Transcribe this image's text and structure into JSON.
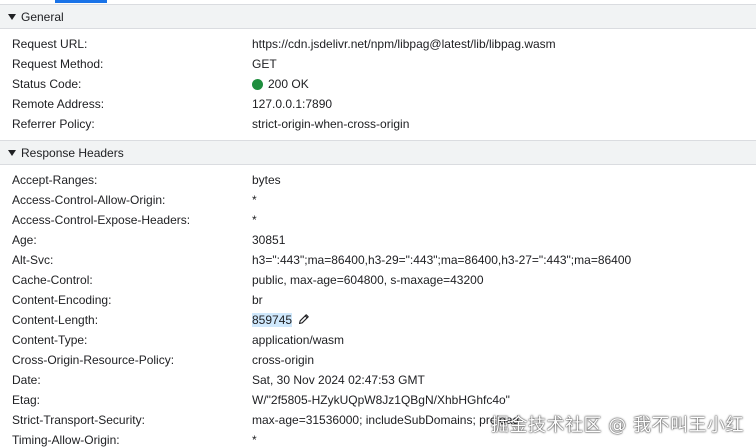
{
  "colors": {
    "status_ok": "#1e8e3e",
    "section_bg": "#f1f3f4",
    "selection_bg": "#cfe8fc",
    "tab_accent": "#1a73e8"
  },
  "general": {
    "title": "General",
    "rows": [
      {
        "key": "Request URL:",
        "value": "https://cdn.jsdelivr.net/npm/libpag@latest/lib/libpag.wasm"
      },
      {
        "key": "Request Method:",
        "value": "GET"
      },
      {
        "key": "Status Code:",
        "value": "200 OK"
      },
      {
        "key": "Remote Address:",
        "value": "127.0.0.1:7890"
      },
      {
        "key": "Referrer Policy:",
        "value": "strict-origin-when-cross-origin"
      }
    ]
  },
  "response_headers": {
    "title": "Response Headers",
    "rows": [
      {
        "key": "Accept-Ranges:",
        "value": "bytes"
      },
      {
        "key": "Access-Control-Allow-Origin:",
        "value": "*"
      },
      {
        "key": "Access-Control-Expose-Headers:",
        "value": "*"
      },
      {
        "key": "Age:",
        "value": "30851"
      },
      {
        "key": "Alt-Svc:",
        "value": "h3=\":443\";ma=86400,h3-29=\":443\";ma=86400,h3-27=\":443\";ma=86400"
      },
      {
        "key": "Cache-Control:",
        "value": "public, max-age=604800, s-maxage=43200"
      },
      {
        "key": "Content-Encoding:",
        "value": "br"
      },
      {
        "key": "Content-Length:",
        "value": "859745"
      },
      {
        "key": "Content-Type:",
        "value": "application/wasm"
      },
      {
        "key": "Cross-Origin-Resource-Policy:",
        "value": "cross-origin"
      },
      {
        "key": "Date:",
        "value": "Sat, 30 Nov 2024 02:47:53 GMT"
      },
      {
        "key": "Etag:",
        "value": "W/\"2f5805-HZykUQpW8Jz1QBgN/XhbHGhfc4o\""
      },
      {
        "key": "Strict-Transport-Security:",
        "value": "max-age=31536000; includeSubDomains; preload"
      },
      {
        "key": "Timing-Allow-Origin:",
        "value": "*"
      }
    ]
  },
  "icons": {
    "collapse": "triangle-down-icon",
    "status": "status-dot-icon",
    "edit": "pencil-icon"
  },
  "watermark": "掘金技术社区 @ 我不叫王小红"
}
